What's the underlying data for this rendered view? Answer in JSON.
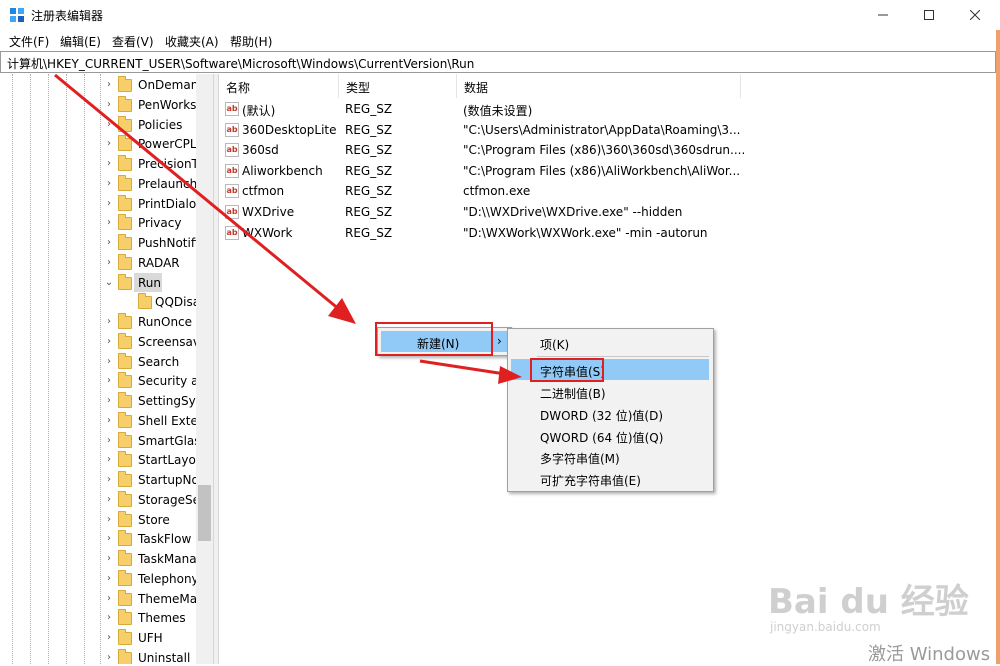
{
  "window": {
    "title": "注册表编辑器",
    "minimize": "—",
    "maximize": "☐",
    "close": "✕"
  },
  "menu": [
    "文件(F)",
    "编辑(E)",
    "查看(V)",
    "收藏夹(A)",
    "帮助(H)"
  ],
  "address": "计算机\\HKEY_CURRENT_USER\\Software\\Microsoft\\Windows\\CurrentVersion\\Run",
  "tree": {
    "items": [
      {
        "label": "OnDeman",
        "expander": "›"
      },
      {
        "label": "PenWorks",
        "expander": "›"
      },
      {
        "label": "Policies",
        "expander": "›"
      },
      {
        "label": "PowerCPL",
        "expander": "›"
      },
      {
        "label": "PrecisionT",
        "expander": "›"
      },
      {
        "label": "Prelaunch",
        "expander": "›"
      },
      {
        "label": "PrintDialog",
        "expander": "›"
      },
      {
        "label": "Privacy",
        "expander": "›"
      },
      {
        "label": "PushNotifi",
        "expander": "›"
      },
      {
        "label": "RADAR",
        "expander": "›"
      },
      {
        "label": "Run",
        "expander": "⌄"
      },
      {
        "label": "QQDisa",
        "expander": ""
      },
      {
        "label": "RunOnce",
        "expander": "›"
      },
      {
        "label": "Screensav",
        "expander": "›"
      },
      {
        "label": "Search",
        "expander": "›"
      },
      {
        "label": "Security ar",
        "expander": "›"
      },
      {
        "label": "SettingSyn",
        "expander": "›"
      },
      {
        "label": "Shell Exter",
        "expander": "›"
      },
      {
        "label": "SmartGlas",
        "expander": "›"
      },
      {
        "label": "StartLayou",
        "expander": "›"
      },
      {
        "label": "StartupNo",
        "expander": "›"
      },
      {
        "label": "StorageSe",
        "expander": "›"
      },
      {
        "label": "Store",
        "expander": "›"
      },
      {
        "label": "TaskFlow",
        "expander": "›"
      },
      {
        "label": "TaskMana",
        "expander": "›"
      },
      {
        "label": "Telephony",
        "expander": "›"
      },
      {
        "label": "ThemeMa",
        "expander": "›"
      },
      {
        "label": "Themes",
        "expander": "›"
      },
      {
        "label": "UFH",
        "expander": "›"
      },
      {
        "label": "Uninstall",
        "expander": "›"
      }
    ]
  },
  "list": {
    "columns": [
      "名称",
      "类型",
      "数据"
    ],
    "rows": [
      {
        "name": "(默认)",
        "type": "REG_SZ",
        "data": "(数值未设置)"
      },
      {
        "name": "360DesktopLite",
        "type": "REG_SZ",
        "data": "\"C:\\Users\\Administrator\\AppData\\Roaming\\3..."
      },
      {
        "name": "360sd",
        "type": "REG_SZ",
        "data": "\"C:\\Program Files (x86)\\360\\360sd\\360sdrun...."
      },
      {
        "name": "Aliworkbench",
        "type": "REG_SZ",
        "data": "\"C:\\Program Files (x86)\\AliWorkbench\\AliWor..."
      },
      {
        "name": "ctfmon",
        "type": "REG_SZ",
        "data": "ctfmon.exe"
      },
      {
        "name": "WXDrive",
        "type": "REG_SZ",
        "data": "\"D:\\\\WXDrive\\WXDrive.exe\" --hidden"
      },
      {
        "name": "WXWork",
        "type": "REG_SZ",
        "data": "\"D:\\WXWork\\WXWork.exe\" -min -autorun"
      }
    ]
  },
  "context_menu": {
    "new_label": "新建(N)",
    "arrow": "›"
  },
  "submenu": {
    "items": [
      "项(K)",
      "字符串值(S)",
      "二进制值(B)",
      "DWORD (32 位)值(D)",
      "QWORD (64 位)值(Q)",
      "多字符串值(M)",
      "可扩充字符串值(E)"
    ]
  },
  "watermark": {
    "logo": "Bai du 经验",
    "url": "jingyan.baidu.com",
    "activate": "激活 Windows"
  },
  "colors": {
    "annotation_red": "#e02020",
    "menu_highlight": "#91c9f7"
  }
}
